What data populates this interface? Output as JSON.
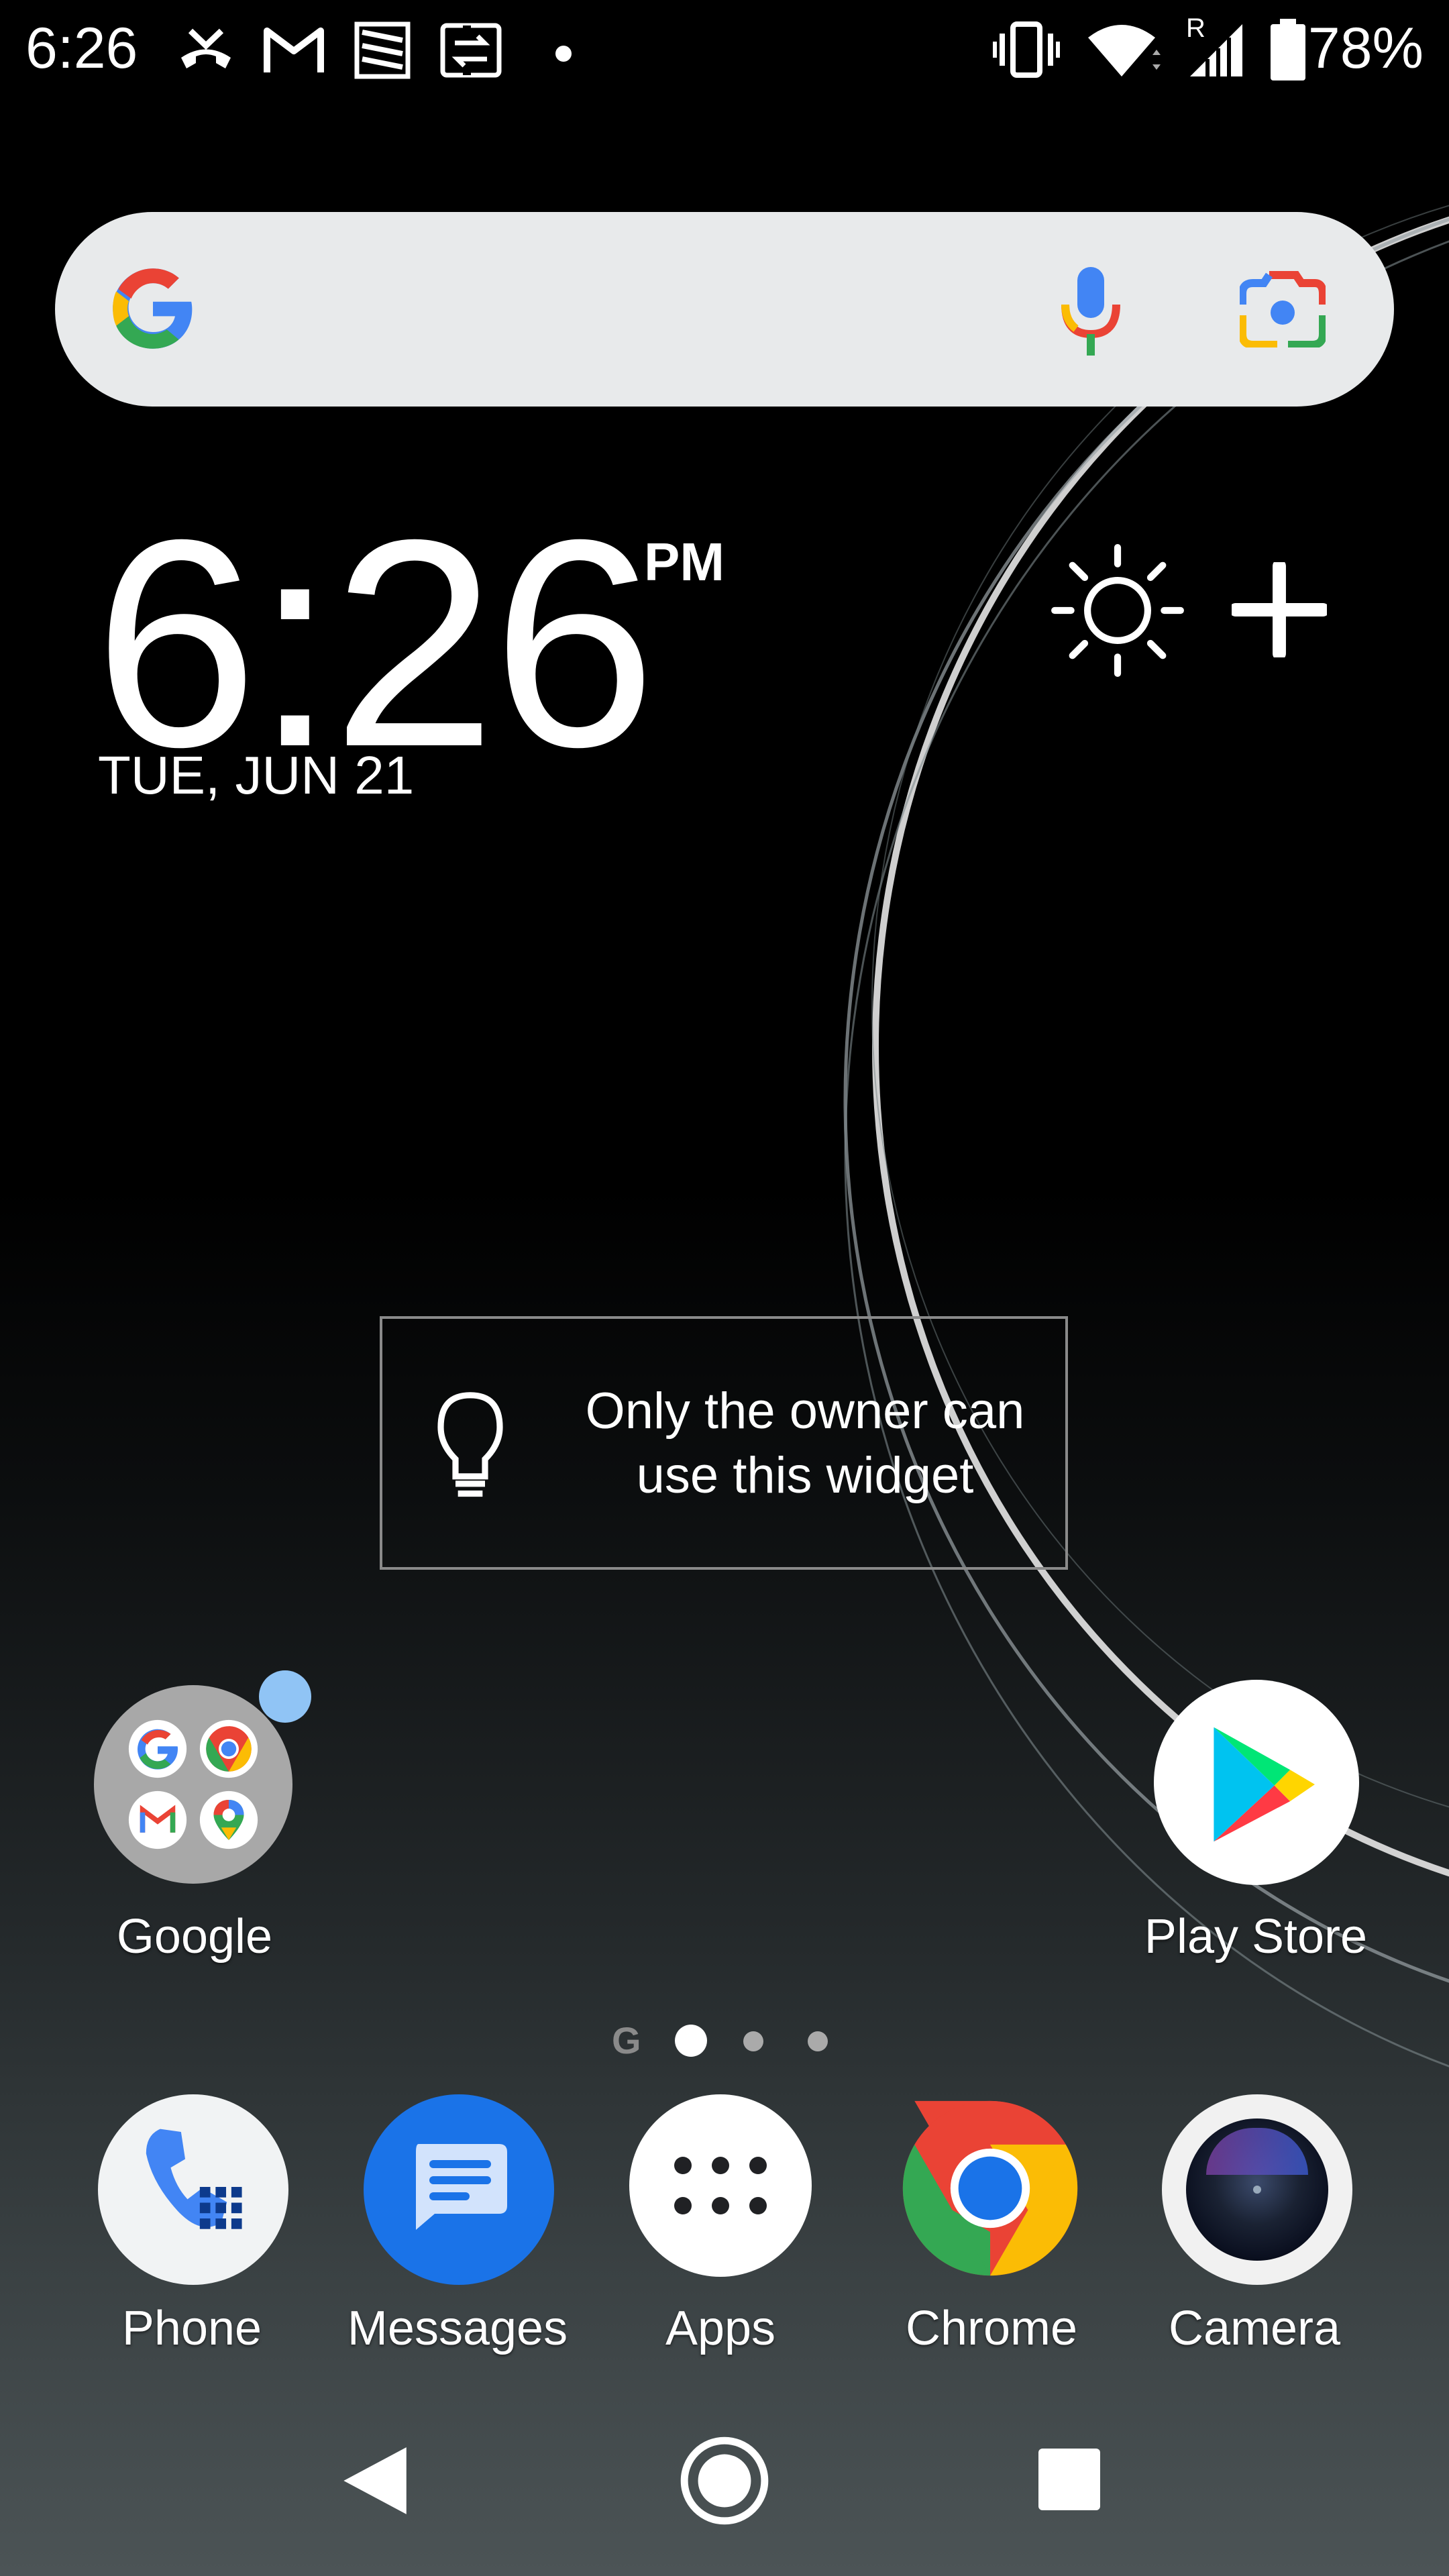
{
  "status_bar": {
    "time": "6:26",
    "battery_percent": "78%",
    "left_icons": [
      "missed-call-icon",
      "gmail-icon",
      "wallet-icon",
      "transfer-icon",
      "dot-icon"
    ],
    "right_icons": [
      "vibrate-icon",
      "wifi-icon",
      "signal-roaming-icon",
      "battery-icon"
    ],
    "roaming_label": "R"
  },
  "search_bar": {
    "icons": [
      "google-logo-icon",
      "mic-icon",
      "lens-icon"
    ]
  },
  "clock_widget": {
    "time": "6:26",
    "ampm": "PM",
    "date": "TUE, JUN 21",
    "weather_icon": "sun-icon",
    "add_icon": "plus-icon"
  },
  "owner_widget": {
    "line1": "Only the owner can",
    "line2": "use this widget",
    "icon": "lightbulb-icon"
  },
  "home_apps": [
    {
      "label": "Google",
      "icon": "google-folder-icon",
      "badge": true
    },
    {
      "label": "Play Store",
      "icon": "play-store-icon"
    }
  ],
  "page_indicator": {
    "pages": 4,
    "current": 1
  },
  "dock": [
    {
      "label": "Phone",
      "icon": "phone-icon"
    },
    {
      "label": "Messages",
      "icon": "messages-icon"
    },
    {
      "label": "Apps",
      "icon": "apps-grid-icon"
    },
    {
      "label": "Chrome",
      "icon": "chrome-icon"
    },
    {
      "label": "Camera",
      "icon": "camera-icon"
    }
  ],
  "nav_bar": [
    "back-icon",
    "home-icon",
    "recents-icon"
  ],
  "colors": {
    "google_blue": "#4285F4",
    "google_red": "#EA4335",
    "google_yellow": "#FBBC05",
    "google_green": "#34A853",
    "messages_blue": "#1a73e8"
  }
}
